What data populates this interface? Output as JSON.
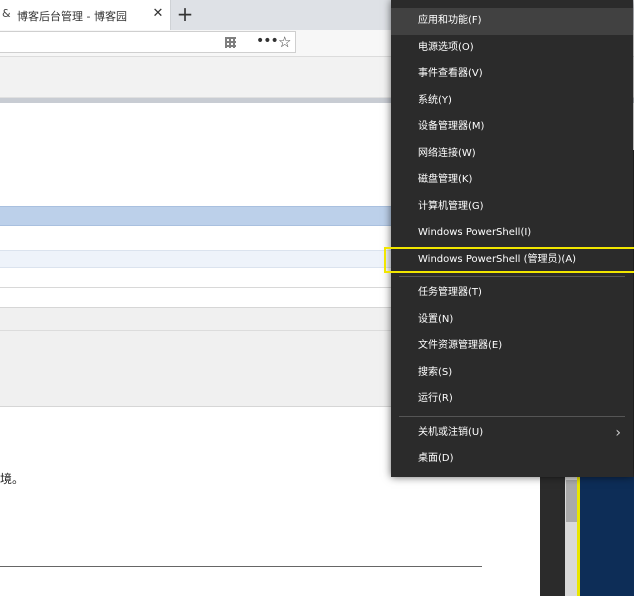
{
  "browser": {
    "tab_title": "博客后台管理 - 博客园",
    "tab_icon": "博客园-icon",
    "tab_icon_glyph": "&",
    "close_glyph": "✕",
    "new_tab_glyph": "+",
    "more_glyph": "•••",
    "star_glyph": "☆"
  },
  "page": {
    "fragment_text": "境。"
  },
  "menu": {
    "groups": [
      [
        {
          "label": "应用和功能(F)",
          "name": "menu-item-apps-features"
        },
        {
          "label": "电源选项(O)",
          "name": "menu-item-power-options"
        },
        {
          "label": "事件查看器(V)",
          "name": "menu-item-event-viewer"
        },
        {
          "label": "系统(Y)",
          "name": "menu-item-system"
        },
        {
          "label": "设备管理器(M)",
          "name": "menu-item-device-manager"
        },
        {
          "label": "网络连接(W)",
          "name": "menu-item-network-connections"
        },
        {
          "label": "磁盘管理(K)",
          "name": "menu-item-disk-management"
        },
        {
          "label": "计算机管理(G)",
          "name": "menu-item-computer-management"
        },
        {
          "label": "Windows PowerShell(I)",
          "name": "menu-item-powershell"
        },
        {
          "label": "Windows PowerShell (管理员)(A)",
          "name": "menu-item-powershell-admin",
          "highlight": true
        }
      ],
      [
        {
          "label": "任务管理器(T)",
          "name": "menu-item-task-manager"
        },
        {
          "label": "设置(N)",
          "name": "menu-item-settings"
        },
        {
          "label": "文件资源管理器(E)",
          "name": "menu-item-file-explorer"
        },
        {
          "label": "搜索(S)",
          "name": "menu-item-search"
        },
        {
          "label": "运行(R)",
          "name": "menu-item-run"
        }
      ],
      [
        {
          "label": "关机或注销(U)",
          "name": "menu-item-shutdown-signout",
          "submenu": true
        },
        {
          "label": "桌面(D)",
          "name": "menu-item-desktop"
        }
      ]
    ],
    "submenu_glyph": "›",
    "colors": {
      "background": "#2b2b2b",
      "highlight_outline": "#f1e600",
      "text": "#ffffff"
    }
  }
}
